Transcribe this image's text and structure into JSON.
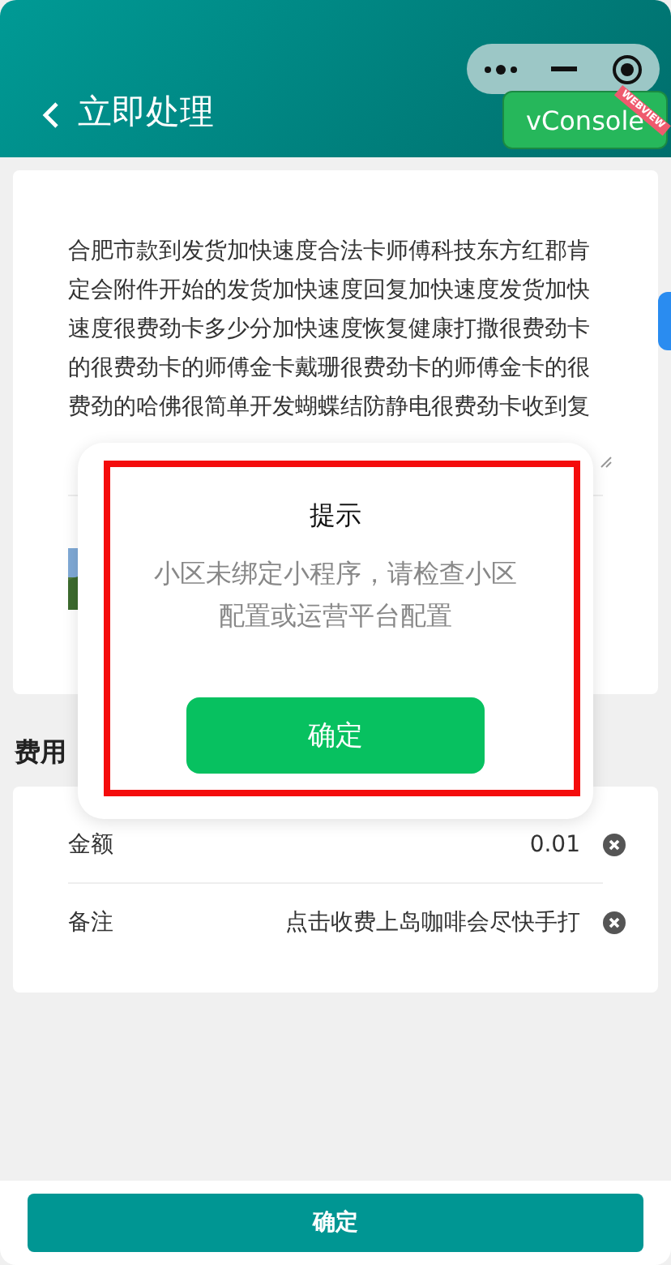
{
  "header": {
    "title": "立即处理"
  },
  "vconsole": {
    "label": "vConsole",
    "ribbon": "WEBVIEW"
  },
  "description": {
    "text": "合肥市款到发货加快速度合法卡师傅科技东方红郡肯定会附件开始的发货加快速度回复加快速度发货加快速度很费劲卡多少分加快速度恢复健康打撒很费劲卡的很费劲卡的师傅金卡戴珊很费劲卡的师傅金卡的很费劲的哈佛很简单开发蝴蝶结防静电很费劲卡收到复"
  },
  "fees": {
    "title": "费用",
    "rows": [
      {
        "label": "金额",
        "value": "0.01"
      },
      {
        "label": "备注",
        "value": "点击收费上岛咖啡会尽快手打"
      }
    ]
  },
  "dialog": {
    "title": "提示",
    "message": "小区未绑定小程序，请检查小区配置或运营平台配置",
    "button": "确定"
  },
  "footer": {
    "button": "确定"
  }
}
